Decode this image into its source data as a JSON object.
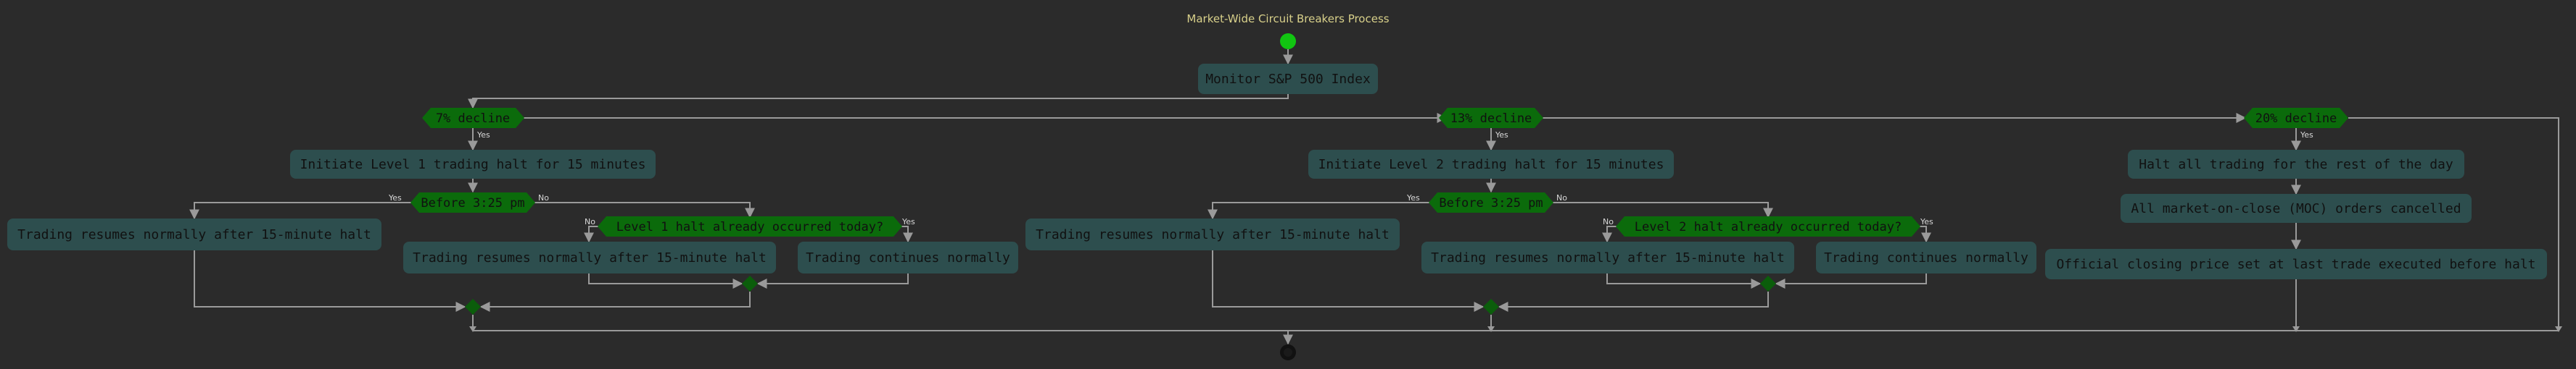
{
  "title": "Market-Wide Circuit Breakers Process",
  "colors": {
    "background": "#2b2b2b",
    "activity_fill": "#2d4e4e",
    "activity_text": "#111111",
    "decision_fill": "#0b6b0b",
    "decision_text": "#111111",
    "merge_fill": "#0b5d0b",
    "start_fill": "#11c511",
    "end_fill": "#111111",
    "line": "#9a9a9a",
    "title_text": "#d8d08a",
    "label_text": "#d8d8d8"
  },
  "activities": {
    "monitor": "Monitor S&P 500 Index",
    "l1_halt": "Initiate Level 1 trading halt for 15 minutes",
    "l1_resume_a": "Trading resumes normally after 15-minute halt",
    "l1_resume_b": "Trading resumes normally after 15-minute halt",
    "l1_continue": "Trading continues normally",
    "l2_halt": "Initiate Level 2 trading halt for 15 minutes",
    "l2_resume_a": "Trading resumes normally after 15-minute halt",
    "l2_resume_b": "Trading resumes normally after 15-minute halt",
    "l2_continue": "Trading continues normally",
    "l3_halt": "Halt all trading for the rest of the day",
    "l3_moc": "All market-on-close (MOC) orders cancelled",
    "l3_close": "Official closing price set at last trade executed before halt"
  },
  "decisions": {
    "d7": "7% decline",
    "d13": "13% decline",
    "d20": "20% decline",
    "l1_time": "Before 3:25 pm",
    "l1_prior": "Level 1 halt already occurred today?",
    "l2_time": "Before 3:25 pm",
    "l2_prior": "Level 2 halt already occurred today?"
  },
  "edge_labels": {
    "yes": "Yes",
    "no": "No"
  }
}
